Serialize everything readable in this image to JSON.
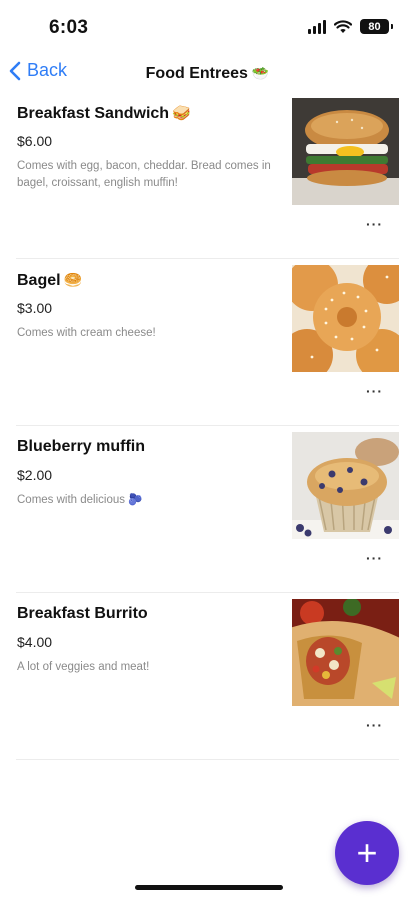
{
  "status_bar": {
    "time": "6:03",
    "battery": "80"
  },
  "nav": {
    "back_label": "Back",
    "title": "Food Entrees",
    "title_emoji": "🥗"
  },
  "items": [
    {
      "name": "Breakfast Sandwich",
      "emoji": "🥪",
      "price": "$6.00",
      "description": "Comes with egg, bacon, cheddar. Bread comes in bagel, croissant, english muffin!",
      "more_label": "···",
      "photo": "breakfast-sandwich-photo"
    },
    {
      "name": "Bagel",
      "emoji": "🥯",
      "price": "$3.00",
      "description": "Comes with cream cheese!",
      "more_label": "···",
      "photo": "bagel-photo"
    },
    {
      "name": "Blueberry muffin",
      "emoji": "",
      "price": "$2.00",
      "description": "Comes with delicious 🫐",
      "more_label": "···",
      "photo": "blueberry-muffin-photo"
    },
    {
      "name": "Breakfast Burrito",
      "emoji": "",
      "price": "$4.00",
      "description": "A lot of veggies and meat!",
      "more_label": "···",
      "photo": "breakfast-burrito-photo"
    }
  ],
  "fab": {
    "label": "+",
    "color": "#5a2fd0"
  },
  "colors": {
    "accent": "#2f7df6",
    "fab": "#5a2fd0"
  }
}
